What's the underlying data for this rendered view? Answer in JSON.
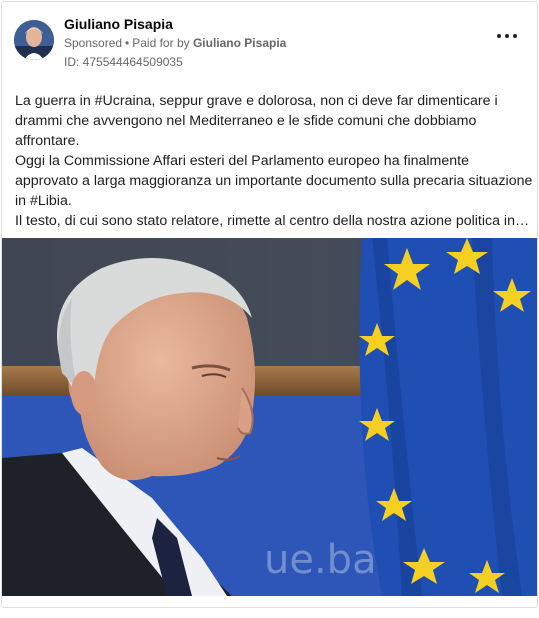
{
  "post": {
    "author": "Giuliano Pisapia",
    "sponsored_label": "Sponsored",
    "separator": "•",
    "paid_for_prefix": "Paid for by",
    "paid_for_by": "Giuliano Pisapia",
    "ad_id": "ID: 475544464509035",
    "more_icon": "more-options-icon",
    "text_lines": [
      "La guerra in #Ucraina, seppur grave e dolorosa, non ci deve far dimenticare i",
      "drammi che avvengono nel Mediterraneo e le sfide comuni che dobbiamo",
      "affrontare.",
      "Oggi la Commissione Affari esteri del Parlamento europeo ha finalmente",
      "approvato a larga maggioranza un importante documento sulla precaria situazione",
      "in #Libia.",
      "Il testo, di cui sono stato relatore, rimette al centro della nostra azione politica in…"
    ],
    "photo": {
      "description_icon": "politician-portrait-photo",
      "flag_color": "#1f4fb3",
      "star_color": "#f5d020"
    }
  }
}
